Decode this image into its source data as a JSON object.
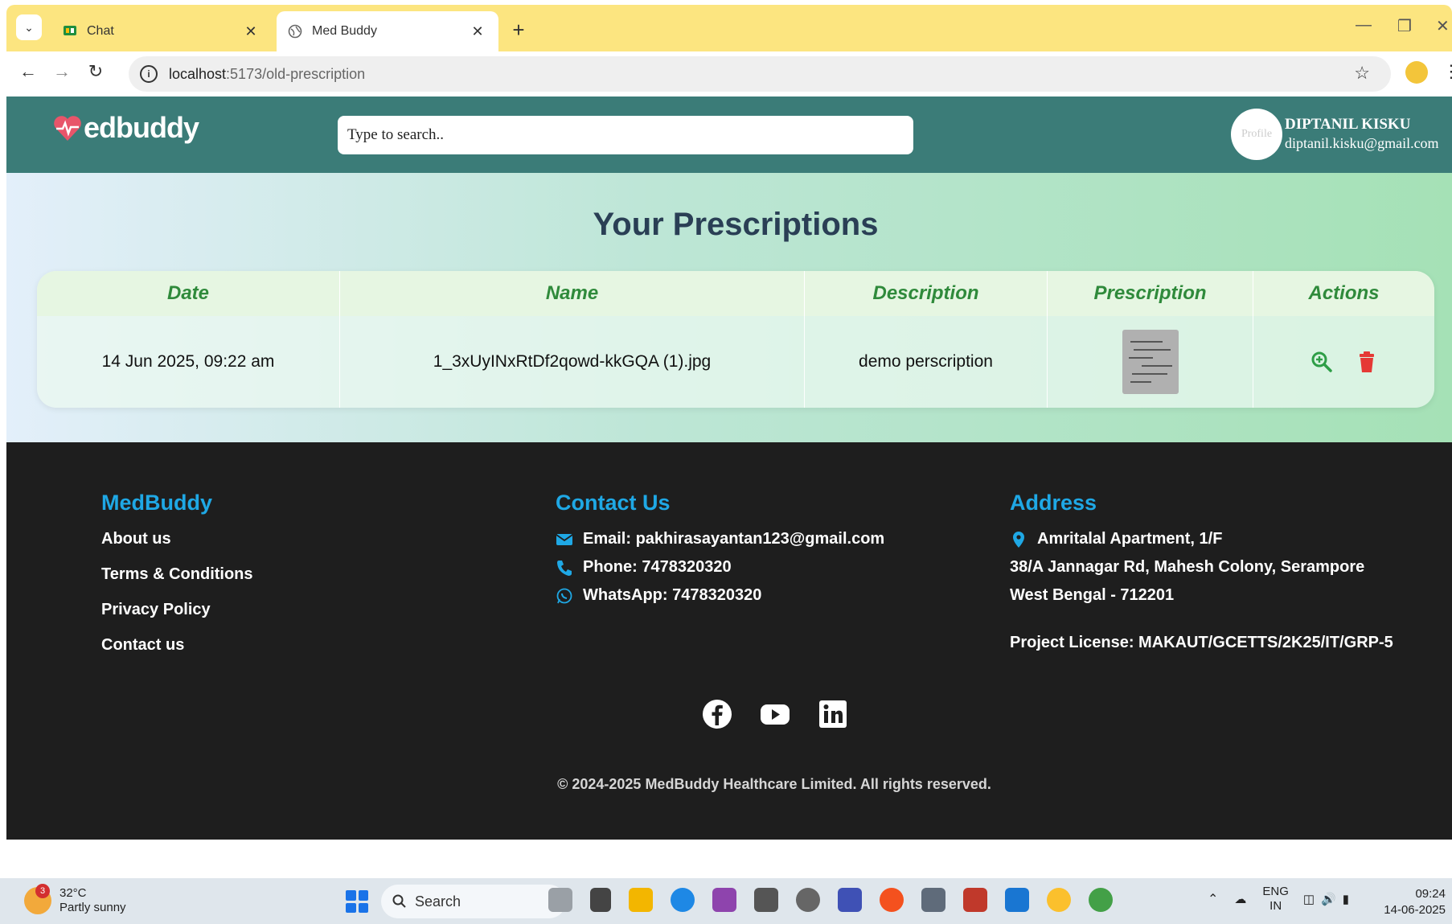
{
  "browser": {
    "tabs": [
      {
        "title": "Chat",
        "active": false
      },
      {
        "title": "Med Buddy",
        "active": true
      }
    ],
    "url_host": "localhost",
    "url_path": ":5173/old-prescription"
  },
  "header": {
    "logo_text": "edbuddy",
    "search_placeholder": "Type to search..",
    "avatar_alt": "Profile",
    "user_name": "DIPTANIL KISKU",
    "user_email": "diptanil.kisku@gmail.com"
  },
  "main": {
    "title": "Your Prescriptions",
    "columns": [
      "Date",
      "Name",
      "Description",
      "Prescription",
      "Actions"
    ],
    "rows": [
      {
        "date": "14 Jun 2025, 09:22 am",
        "name": "1_3xUyINxRtDf2qowd-kkGQA (1).jpg",
        "description": "demo perscription"
      }
    ]
  },
  "footer": {
    "medbuddy": {
      "heading": "MedBuddy",
      "links": [
        "About us",
        "Terms & Conditions",
        "Privacy Policy",
        "Contact us"
      ]
    },
    "contact": {
      "heading": "Contact Us",
      "email": "Email: pakhirasayantan123@gmail.com",
      "phone": "Phone: 7478320320",
      "whatsapp": "WhatsApp: 7478320320"
    },
    "address": {
      "heading": "Address",
      "line1": "Amritalal Apartment, 1/F",
      "line2": "38/A Jannagar Rd, Mahesh Colony, Serampore",
      "line3": "West Bengal - 712201",
      "license": "Project License: MAKAUT/GCETTS/2K25/IT/GRP-5"
    },
    "copyright": "© 2024-2025 MedBuddy Healthcare Limited. All rights reserved."
  },
  "taskbar": {
    "weather_temp": "32°C",
    "weather_desc": "Partly sunny",
    "weather_badge": "3",
    "search_label": "Search",
    "lang_top": "ENG",
    "lang_bottom": "IN",
    "time": "09:24",
    "date": "14-06-2025"
  },
  "colors": {
    "header_bg": "#3b7c78",
    "accent_green": "#2f8a3b",
    "footer_heading": "#1fa8e5",
    "delete_red": "#e53935",
    "zoom_green": "#2e9e47"
  }
}
